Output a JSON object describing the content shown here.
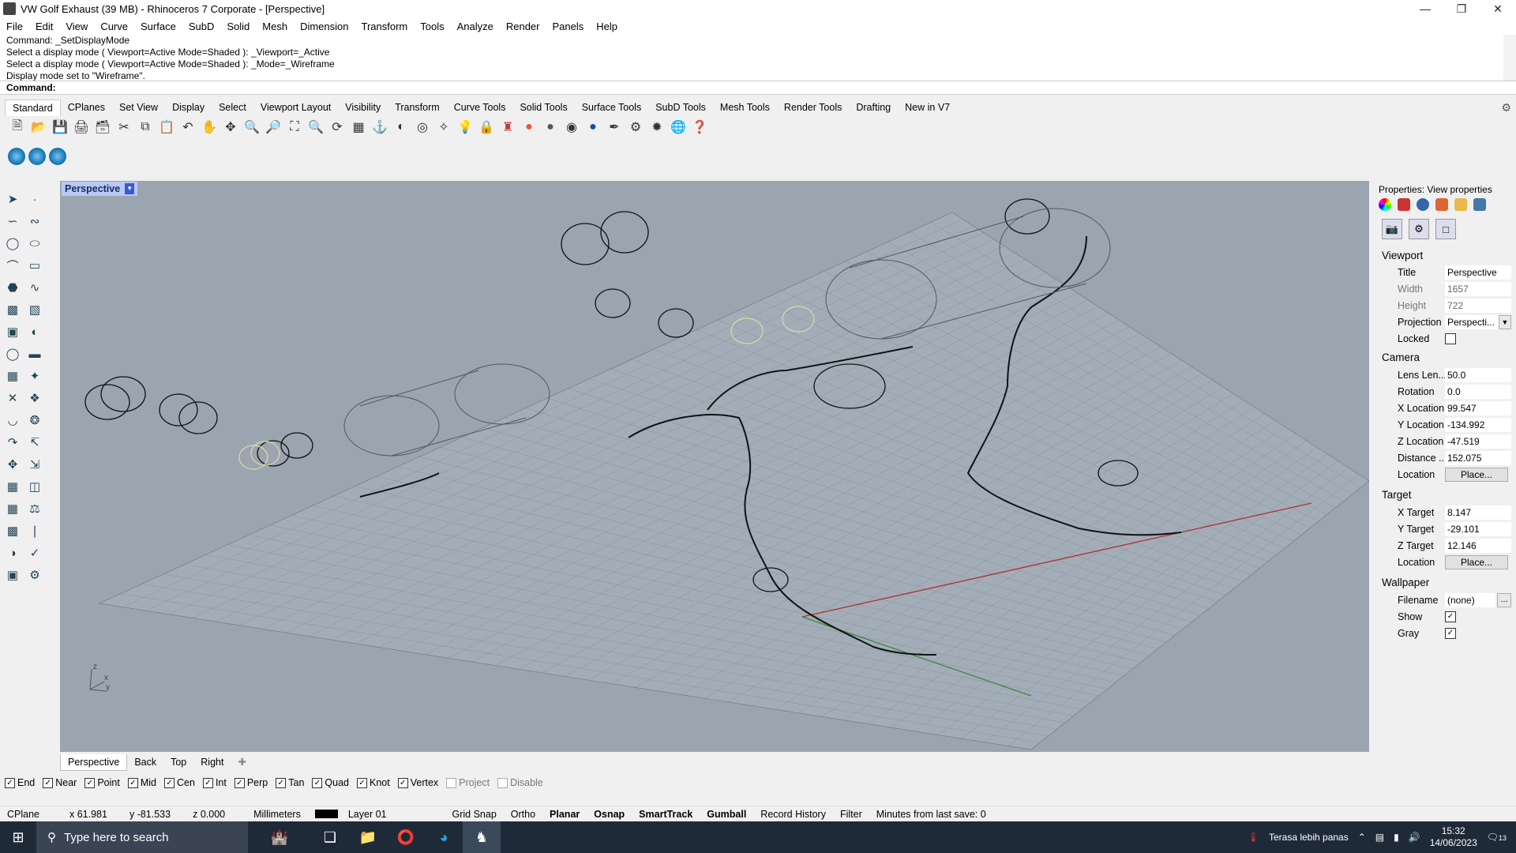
{
  "window": {
    "title": "VW Golf Exhaust (39 MB) - Rhinoceros 7 Corporate - [Perspective]"
  },
  "menu": [
    "File",
    "Edit",
    "View",
    "Curve",
    "Surface",
    "SubD",
    "Solid",
    "Mesh",
    "Dimension",
    "Transform",
    "Tools",
    "Analyze",
    "Render",
    "Panels",
    "Help"
  ],
  "command": {
    "history": [
      "Command: _SetDisplayMode",
      "Select a display mode ( Viewport=Active  Mode=Shaded ): _Viewport=_Active",
      "Select a display mode ( Viewport=Active  Mode=Shaded ): _Mode=_Wireframe",
      "Display mode set to \"Wireframe\"."
    ],
    "prompt": "Command:"
  },
  "toolbar_tabs": [
    "Standard",
    "CPlanes",
    "Set View",
    "Display",
    "Select",
    "Viewport Layout",
    "Visibility",
    "Transform",
    "Curve Tools",
    "Solid Tools",
    "Surface Tools",
    "SubD Tools",
    "Mesh Tools",
    "Render Tools",
    "Drafting",
    "New in V7"
  ],
  "viewport": {
    "label": "Perspective",
    "axes": {
      "z": "z",
      "x": "x",
      "y": "y"
    }
  },
  "view_tabs": [
    "Perspective",
    "Back",
    "Top",
    "Right"
  ],
  "osnaps": [
    {
      "label": "End",
      "checked": true
    },
    {
      "label": "Near",
      "checked": true
    },
    {
      "label": "Point",
      "checked": true
    },
    {
      "label": "Mid",
      "checked": true
    },
    {
      "label": "Cen",
      "checked": true
    },
    {
      "label": "Int",
      "checked": true
    },
    {
      "label": "Perp",
      "checked": true
    },
    {
      "label": "Tan",
      "checked": true
    },
    {
      "label": "Quad",
      "checked": true
    },
    {
      "label": "Knot",
      "checked": true
    },
    {
      "label": "Vertex",
      "checked": true
    },
    {
      "label": "Project",
      "checked": false
    },
    {
      "label": "Disable",
      "checked": false
    }
  ],
  "status": {
    "cplane": "CPlane",
    "x": "x 61.981",
    "y": "y -81.533",
    "z": "z 0.000",
    "units": "Millimeters",
    "layer": "Layer 01",
    "toggles": [
      "Grid Snap",
      "Ortho",
      "Planar",
      "Osnap",
      "SmartTrack",
      "Gumball",
      "Record History",
      "Filter"
    ],
    "save_info": "Minutes from last save: 0"
  },
  "properties": {
    "title": "Properties: View properties",
    "viewport_section": "Viewport",
    "title_label": "Title",
    "title_value": "Perspective",
    "width_label": "Width",
    "width_value": "1657",
    "height_label": "Height",
    "height_value": "722",
    "projection_label": "Projection",
    "projection_value": "Perspecti...",
    "locked_label": "Locked",
    "camera_section": "Camera",
    "lens_label": "Lens Len...",
    "lens_value": "50.0",
    "rotation_label": "Rotation",
    "rotation_value": "0.0",
    "xloc_label": "X Location",
    "xloc_value": "99.547",
    "yloc_label": "Y Location",
    "yloc_value": "-134.992",
    "zloc_label": "Z Location",
    "zloc_value": "-47.519",
    "distance_label": "Distance ...",
    "distance_value": "152.075",
    "location_label": "Location",
    "place_label": "Place...",
    "target_section": "Target",
    "xtarget_label": "X Target",
    "xtarget_value": "8.147",
    "ytarget_label": "Y Target",
    "ytarget_value": "-29.101",
    "ztarget_label": "Z Target",
    "ztarget_value": "12.146",
    "target_location_label": "Location",
    "target_place_label": "Place...",
    "wallpaper_section": "Wallpaper",
    "filename_label": "Filename",
    "filename_value": "(none)",
    "filename_btn": "...",
    "show_label": "Show",
    "gray_label": "Gray"
  },
  "taskbar": {
    "search_placeholder": "Type here to search",
    "weather": "Terasa lebih panas",
    "time": "15:32",
    "date": "14/06/2023",
    "notifications": "13"
  }
}
